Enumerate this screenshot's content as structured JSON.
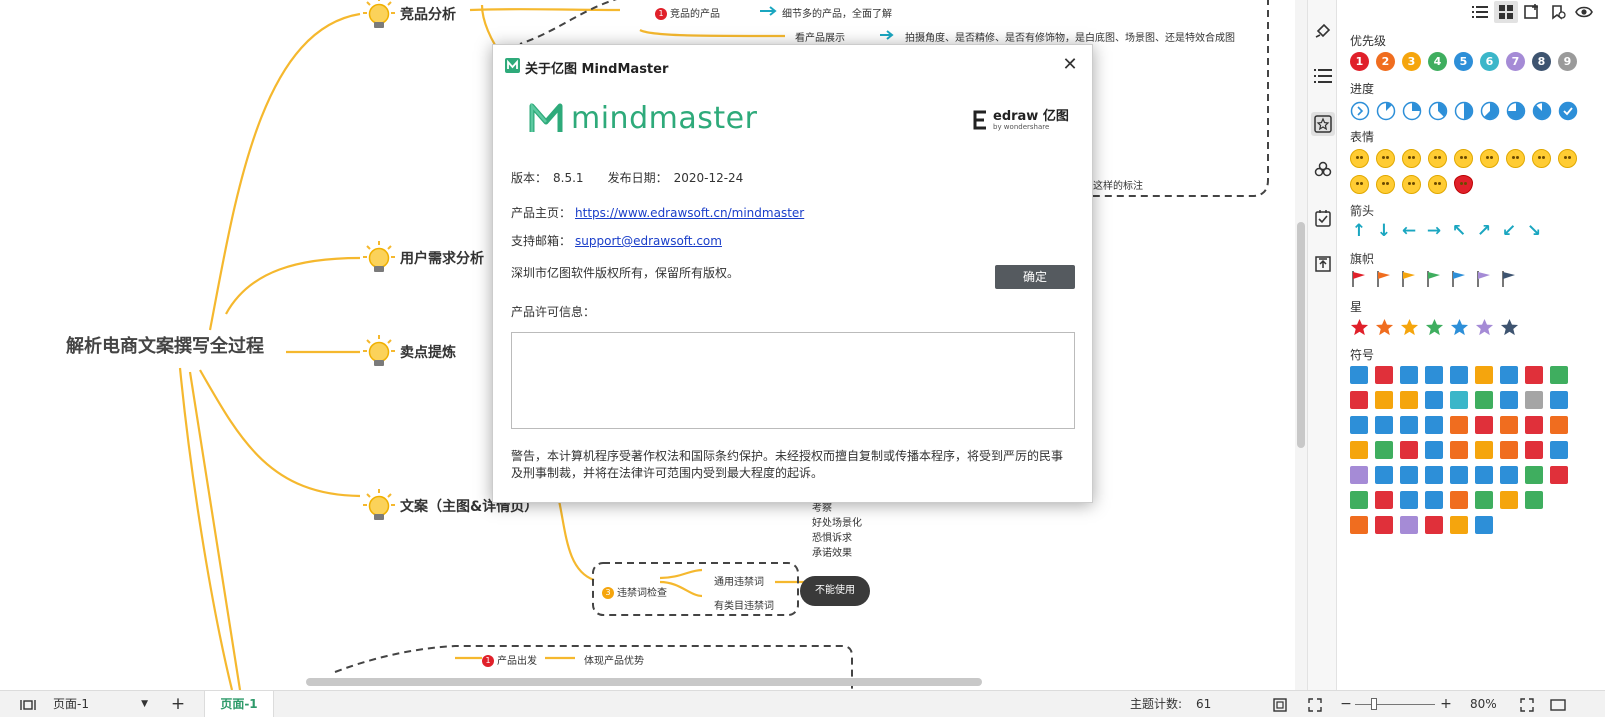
{
  "canvas": {
    "root_topic": "解析电商文案撰写全过程",
    "branches": [
      {
        "label": "竞品分析"
      },
      {
        "label": "用户需求分析"
      },
      {
        "label": "卖点提炼"
      },
      {
        "label": "文案（主图&详情页）"
      }
    ],
    "nodes": {
      "competitor_product": "竞品的产品",
      "detail_rich": "细节多的产品，全面了解",
      "look_display": "看产品展示",
      "display_desc": "拍摄角度、是否精修、是否有修饰物，是白底图、场景图、还是特效合成图",
      "partial_note": "这样的标注",
      "list_1": "考察",
      "list_2": "好处场景化",
      "list_3": "恐惧诉求",
      "list_4": "承诺效果",
      "banned_check": "违禁词检查",
      "banned_general": "通用违禁词",
      "banned_category": "有类目违禁词",
      "cannot_use": "不能使用",
      "product_start": "产品出发",
      "show_advantage": "体现产品优势"
    },
    "badge_numbers": {
      "one": "1",
      "three": "3"
    }
  },
  "dialog": {
    "title": "关于亿图 MindMaster",
    "brand": "mindmaster",
    "edraw_name": "edraw 亿图",
    "edraw_sub": "by wondershare",
    "version_label": "版本：",
    "version": "8.5.1",
    "release_label": "发布日期：",
    "release_date": "2020-12-24",
    "homepage_label": "产品主页：",
    "homepage_url": "https://www.edrawsoft.cn/mindmaster",
    "email_label": "支持邮箱：",
    "email": "support@edrawsoft.com",
    "copyright": "深圳市亿图软件版权所有，保留所有版权。",
    "ok_label": "确定",
    "license_label": "产品许可信息：",
    "license_text": "",
    "warning": "警告，本计算机程序受著作权法和国际条约保护。未经授权而擅自复制或传播本程序，将受到严厉的民事及刑事制裁，并将在法律许可范围内受到最大程度的起诉。",
    "close_icon": "close-icon"
  },
  "panel": {
    "priority_title": "优先级",
    "priority": [
      {
        "n": "1",
        "color": "#e0202a"
      },
      {
        "n": "2",
        "color": "#f06d1f"
      },
      {
        "n": "3",
        "color": "#f5a50d"
      },
      {
        "n": "4",
        "color": "#3fae5f"
      },
      {
        "n": "5",
        "color": "#2d8fd8"
      },
      {
        "n": "6",
        "color": "#3bb6c9"
      },
      {
        "n": "7",
        "color": "#a58bd6"
      },
      {
        "n": "8",
        "color": "#3e5470"
      },
      {
        "n": "9",
        "color": "#9a9a9a"
      }
    ],
    "progress_title": "进度",
    "progress_values": [
      0,
      0.125,
      0.25,
      0.375,
      0.5,
      0.625,
      0.75,
      0.875,
      1
    ],
    "emotion_title": "表情",
    "emotion_count": 14,
    "arrow_title": "箭头",
    "arrows": [
      "↑",
      "↓",
      "←",
      "→",
      "↖",
      "↗",
      "↙",
      "↘"
    ],
    "flag_title": "旗帜",
    "flags": [
      "#e0202a",
      "#f06d1f",
      "#f5a50d",
      "#3fae5f",
      "#2d8fd8",
      "#a58bd6",
      "#3e5470"
    ],
    "star_title": "星",
    "stars": [
      "#e0202a",
      "#f06d1f",
      "#f5a50d",
      "#3fae5f",
      "#2d8fd8",
      "#a58bd6",
      "#3e5470"
    ],
    "symbol_title": "符号",
    "symbols": [
      [
        "#2d8fd8",
        "#e0303a",
        "#2d8fd8",
        "#2d8fd8",
        "#2d8fd8",
        "#f5a50d",
        "#2d8fd8",
        "#e0303a",
        "#3fae5f"
      ],
      [
        "#e0303a",
        "#f5a50d",
        "#f5a50d",
        "#2d8fd8",
        "#3bb6c9",
        "#3fae5f",
        "#2d8fd8",
        "#a5a5a5",
        "#2d8fd8"
      ],
      [
        "#2d8fd8",
        "#2d8fd8",
        "#2d8fd8",
        "#2d8fd8",
        "#f06d1f",
        "#e0303a",
        "#f06d1f",
        "#e0303a",
        "#f06d1f"
      ],
      [
        "#f5a50d",
        "#3fae5f",
        "#e0303a",
        "#2d8fd8",
        "#f06d1f",
        "#f5a50d",
        "#f06d1f",
        "#e0303a",
        "#2d8fd8"
      ],
      [
        "#a58bd6",
        "#2d8fd8",
        "#2d8fd8",
        "#2d8fd8",
        "#2d8fd8",
        "#2d8fd8",
        "#2d8fd8",
        "#3fae5f",
        "#e0303a"
      ],
      [
        "#3fae5f",
        "#e0303a",
        "#2d8fd8",
        "#2d8fd8",
        "#f06d1f",
        "#3fae5f",
        "#f5a50d",
        "#3fae5f"
      ],
      [
        "#f06d1f",
        "#e0303a",
        "#a58bd6",
        "#e0303a",
        "#f5a50d",
        "#2d8fd8"
      ]
    ]
  },
  "statusbar": {
    "page_select": "页面-1",
    "add_page": "+",
    "page_tab": "页面-1",
    "topic_count_label": "主题计数:",
    "topic_count": "61",
    "zoom_minus": "−",
    "zoom_plus": "+",
    "zoom_value": "80%",
    "zoom_fraction": 0.24
  }
}
